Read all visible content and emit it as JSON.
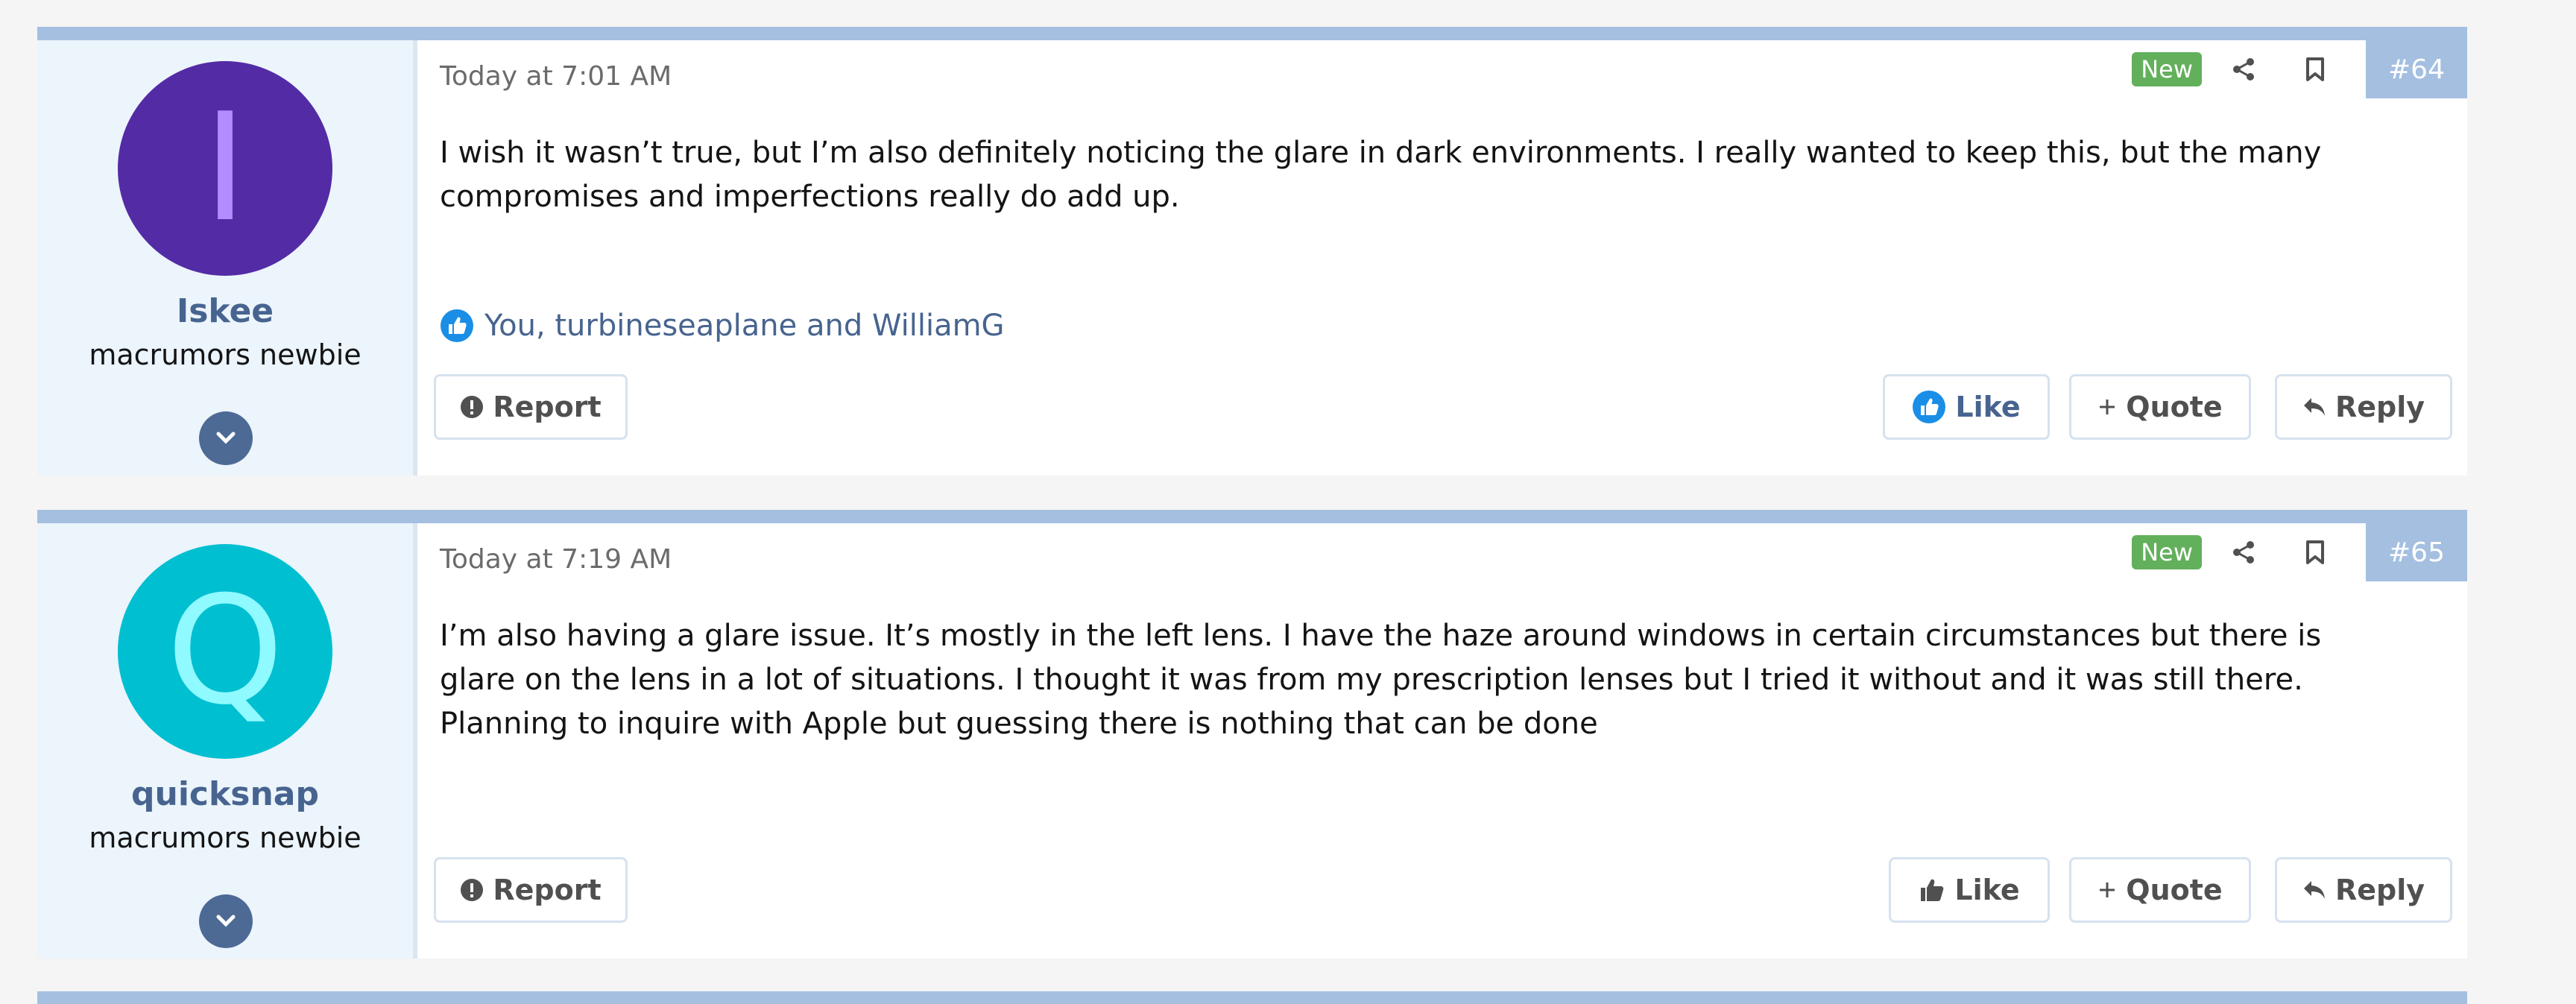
{
  "posts": [
    {
      "author": "Iskee",
      "avatar_letter": "I",
      "avatar_color": "#532ba5",
      "user_title": "macrumors newbie",
      "date": "Today at 7:01 AM",
      "badge": "New",
      "post_number": "#64",
      "body_lines": [
        "I wish it wasn’t true, but I’m also definitely noticing the glare in dark environments. I really wanted to keep this, but the many",
        "compromises and imperfections really do add up."
      ],
      "reactions_text": "You, turbineseaplane and WilliamG",
      "actions": {
        "report": "Report",
        "like": "Like",
        "quote": "Quote",
        "reply": "Reply"
      },
      "liked": true
    },
    {
      "author": "quicksnap",
      "avatar_letter": "Q",
      "avatar_color": "#00bfd1",
      "user_title": "macrumors newbie",
      "date": "Today at 7:19 AM",
      "badge": "New",
      "post_number": "#65",
      "body_lines": [
        "I’m also having a glare issue. It’s mostly in the left lens. I have the haze around windows in certain circumstances but there is",
        "glare on the lens in a lot of situations. I thought it was from my prescription lenses but I tried it without and it was still there.",
        "Planning to inquire with Apple but guessing there is nothing that can be done"
      ],
      "actions": {
        "report": "Report",
        "like": "Like",
        "quote": "Quote",
        "reply": "Reply"
      },
      "liked": false
    }
  ],
  "icons": {
    "share": "share-icon",
    "bookmark": "bookmark-icon",
    "expand": "chevron-down-icon",
    "report": "exclamation-circle-icon",
    "like": "thumbs-up-icon",
    "quote": "plus-icon",
    "reply": "reply-arrow-icon"
  },
  "colors": {
    "accent": "#a4bfe0",
    "link": "#47648f",
    "new_badge": "#63b05c",
    "like_blue": "#1a8ee6"
  }
}
